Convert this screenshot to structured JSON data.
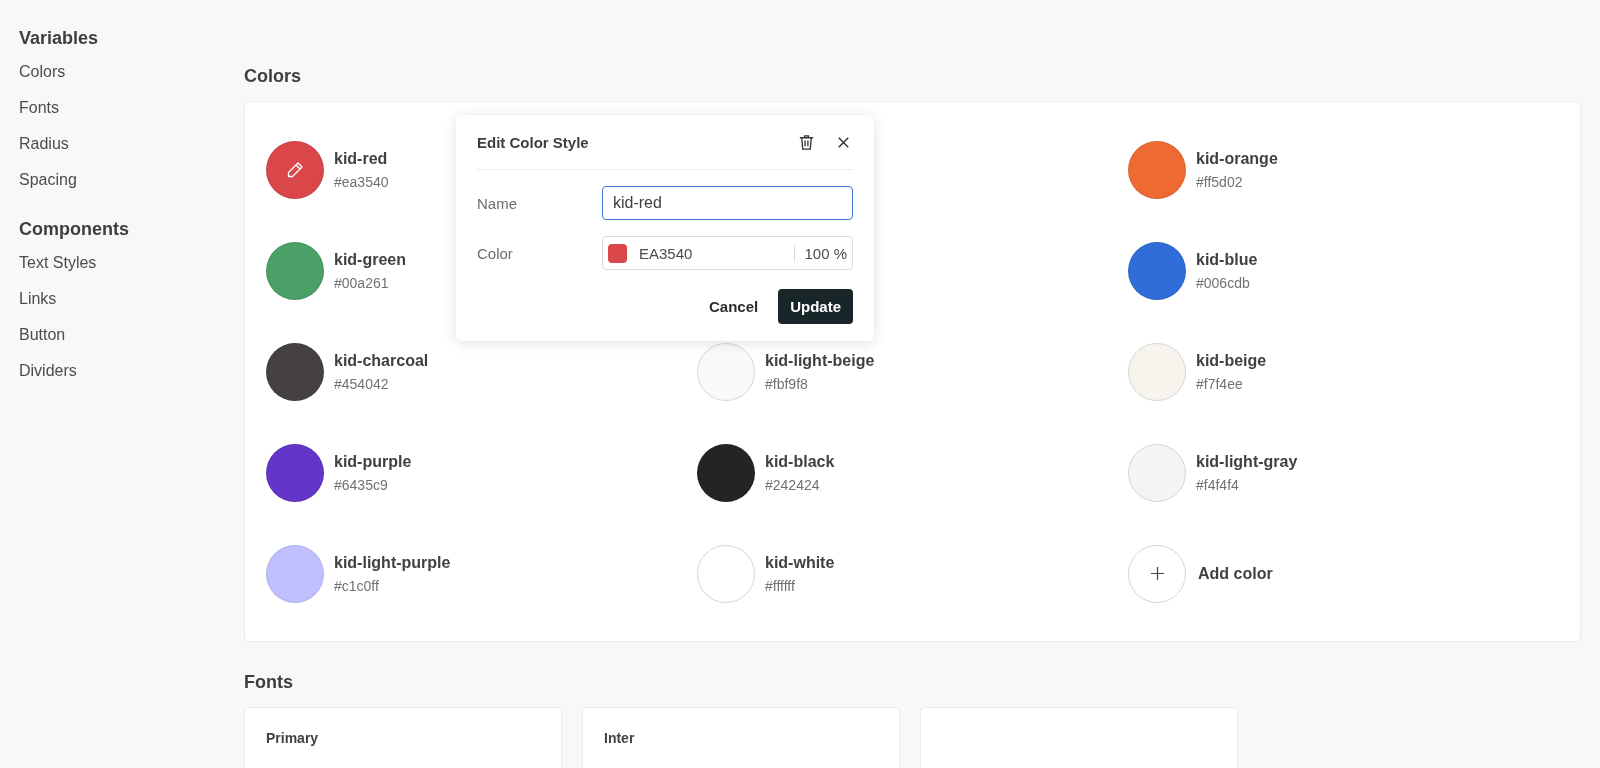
{
  "sidebar": {
    "sections": [
      {
        "title": "Variables",
        "items": [
          {
            "label": "Colors"
          },
          {
            "label": "Fonts"
          },
          {
            "label": "Radius"
          },
          {
            "label": "Spacing"
          }
        ]
      },
      {
        "title": "Components",
        "items": [
          {
            "label": "Text Styles"
          },
          {
            "label": "Links"
          },
          {
            "label": "Button"
          },
          {
            "label": "Dividers"
          }
        ]
      }
    ]
  },
  "colors": {
    "heading": "Colors",
    "rows": [
      {
        "cells": [
          {
            "kind": "swatch",
            "name": "kid-red",
            "hex": "#ea3540",
            "color": "#d9474b",
            "editing": true
          },
          {
            "kind": "covered"
          },
          {
            "kind": "swatch",
            "name": "kid-orange",
            "hex": "#ff5d02",
            "color": "#ee6a32",
            "editing": false
          }
        ]
      },
      {
        "cells": [
          {
            "kind": "swatch",
            "name": "kid-green",
            "hex": "#00a261",
            "color": "#4aa066",
            "editing": false
          },
          {
            "kind": "covered"
          },
          {
            "kind": "swatch",
            "name": "kid-blue",
            "hex": "#006cdb",
            "color": "#2f6dd8",
            "editing": false
          }
        ]
      },
      {
        "cells": [
          {
            "kind": "swatch",
            "name": "kid-charcoal",
            "hex": "#454042",
            "color": "#454042",
            "editing": false
          },
          {
            "kind": "swatch",
            "name": "kid-light-beige",
            "hex": "#fbf9f8",
            "color": "#fbf9f8",
            "editing": false
          },
          {
            "kind": "swatch",
            "name": "kid-beige",
            "hex": "#f7f4ee",
            "color": "#f7f4ee",
            "editing": false
          }
        ]
      },
      {
        "cells": [
          {
            "kind": "swatch",
            "name": "kid-purple",
            "hex": "#6435c9",
            "color": "#6435c9",
            "editing": false
          },
          {
            "kind": "swatch",
            "name": "kid-black",
            "hex": "#242424",
            "color": "#242424",
            "editing": false
          },
          {
            "kind": "swatch",
            "name": "kid-light-gray",
            "hex": "#f4f4f4",
            "color": "#f4f4f4",
            "editing": false
          }
        ]
      },
      {
        "cells": [
          {
            "kind": "swatch",
            "name": "kid-light-purple",
            "hex": "#c1c0ff",
            "color": "#c1c0ff",
            "editing": false
          },
          {
            "kind": "swatch",
            "name": "kid-white",
            "hex": "#ffffff",
            "color": "#ffffff",
            "editing": false
          },
          {
            "kind": "add",
            "label": "Add color"
          }
        ]
      }
    ]
  },
  "dialog": {
    "title": "Edit Color Style",
    "name_label": "Name",
    "name_value": "kid-red",
    "color_label": "Color",
    "color_value": "EA3540",
    "opacity": "100 %",
    "cancel": "Cancel",
    "confirm": "Update"
  },
  "fonts": {
    "heading": "Fonts",
    "cards": [
      {
        "kind": "font",
        "label": "Primary"
      },
      {
        "kind": "font",
        "label": "Inter"
      },
      {
        "kind": "blank"
      }
    ]
  }
}
